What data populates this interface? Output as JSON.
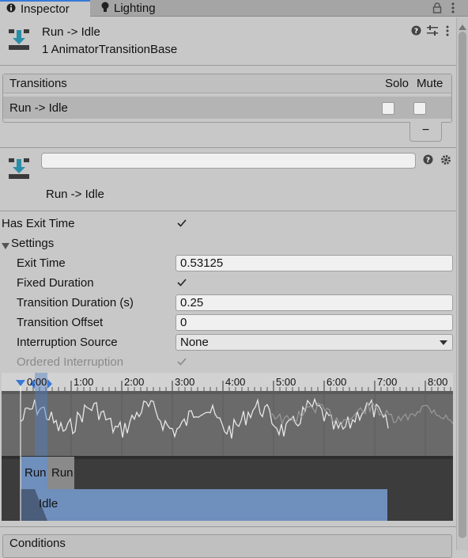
{
  "tabs": [
    {
      "label": "Inspector",
      "active": true
    },
    {
      "label": "Lighting",
      "active": false
    }
  ],
  "header": {
    "title": "Run -> Idle",
    "subtitle": "1 AnimatorTransitionBase"
  },
  "transitions": {
    "header_label": "Transitions",
    "solo_label": "Solo",
    "mute_label": "Mute",
    "rows": [
      {
        "name": "Run -> Idle",
        "solo": false,
        "mute": false
      }
    ],
    "remove_label": "−"
  },
  "transition_detail": {
    "name_value": "",
    "caption": "Run -> Idle"
  },
  "properties": {
    "has_exit_time": {
      "label": "Has Exit Time",
      "checked": true
    },
    "settings_label": "Settings",
    "exit_time": {
      "label": "Exit Time",
      "value": "0.53125"
    },
    "fixed_duration": {
      "label": "Fixed Duration",
      "checked": true
    },
    "transition_duration": {
      "label": "Transition Duration (s)",
      "value": "0.25"
    },
    "transition_offset": {
      "label": "Transition Offset",
      "value": "0"
    },
    "interruption_source": {
      "label": "Interruption Source",
      "value": "None"
    },
    "ordered_interruption": {
      "label": "Ordered Interruption",
      "checked": true
    }
  },
  "timeline": {
    "ticks": [
      "1:00",
      "2:00",
      "3:00",
      "4:00",
      "5:00",
      "6:00",
      "7:00",
      "8:00"
    ],
    "marker_label": "0:00",
    "source_state": "Run",
    "source_state_repeat": "Run",
    "dest_state": "Idle"
  },
  "conditions_label": "Conditions",
  "colors": {
    "accent": "#3a79d8",
    "panel": "#c8c8c8",
    "timeline_bg": "#6e6e6e",
    "state_blue": "#6f8fbd"
  }
}
